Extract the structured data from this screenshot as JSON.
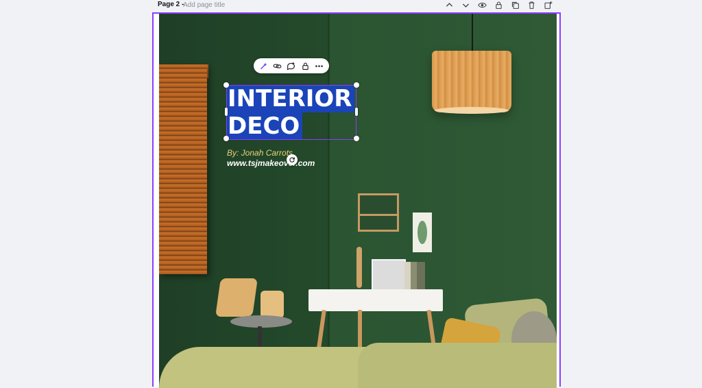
{
  "page_header": {
    "label": "Page 2 -",
    "title_placeholder": "Add page title",
    "icons": [
      "chevron-up-icon",
      "chevron-down-icon",
      "eye-icon",
      "lock-icon",
      "duplicate-icon",
      "trash-icon",
      "add-page-icon"
    ]
  },
  "floating_toolbar": {
    "icons": [
      "magic-edit-icon",
      "link-icon",
      "comment-icon",
      "lock-icon",
      "more-icon"
    ]
  },
  "design": {
    "title_line1": "INTERIOR",
    "title_line2": "DECO",
    "byline": "By: Jonah Carrots",
    "website": "www.tsjmakeover.com"
  },
  "colors": {
    "selection": "#8b3dff",
    "title_highlight": "#1a44b8",
    "byline_text": "#e9d17e",
    "wall_green": "#284d2e"
  }
}
